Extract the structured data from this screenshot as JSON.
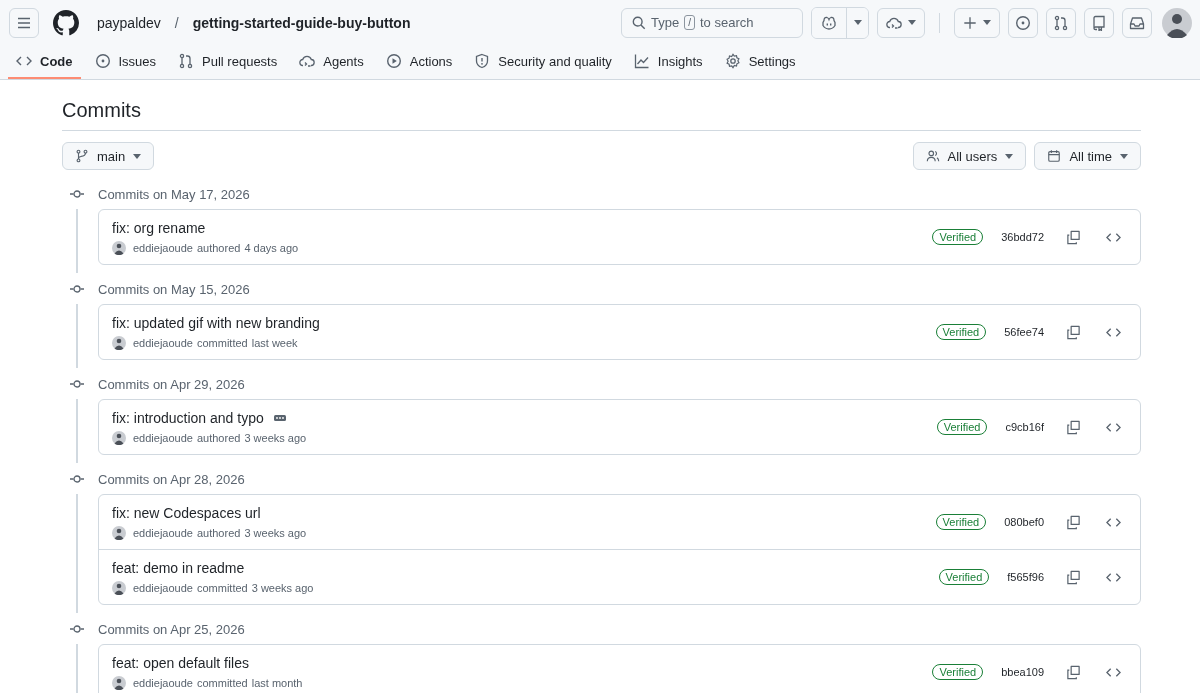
{
  "header": {
    "owner": "paypaldev",
    "separator": "/",
    "repo": "getting-started-guide-buy-button",
    "search": {
      "placeholder_parts": [
        "Type",
        "/",
        "to search"
      ]
    }
  },
  "tabs": [
    {
      "label": "Code",
      "selected": true
    },
    {
      "label": "Issues",
      "selected": false
    },
    {
      "label": "Pull requests",
      "selected": false
    },
    {
      "label": "Agents",
      "selected": false
    },
    {
      "label": "Actions",
      "selected": false
    },
    {
      "label": "Security and quality",
      "selected": false
    },
    {
      "label": "Insights",
      "selected": false
    },
    {
      "label": "Settings",
      "selected": false
    }
  ],
  "page_title": "Commits",
  "branch": "main",
  "filters": [
    {
      "label": "All users"
    },
    {
      "label": "All time"
    }
  ],
  "groups": [
    {
      "date": "Commits on May 17, 2026",
      "commits": [
        {
          "title": "fix: org rename",
          "has_more": false,
          "author": "eddiejaoude",
          "action": "authored",
          "time": "4 days ago",
          "badge": "Verified",
          "sha": "36bdd72"
        }
      ]
    },
    {
      "date": "Commits on May 15, 2026",
      "commits": [
        {
          "title": "fix: updated gif with new branding",
          "has_more": false,
          "author": "eddiejaoude",
          "action": "committed",
          "time": "last week",
          "badge": "Verified",
          "sha": "56fee74"
        }
      ]
    },
    {
      "date": "Commits on Apr 29, 2026",
      "commits": [
        {
          "title": "fix: introduction and typo",
          "has_more": true,
          "author": "eddiejaoude",
          "action": "authored",
          "time": "3 weeks ago",
          "badge": "Verified",
          "sha": "c9cb16f"
        }
      ]
    },
    {
      "date": "Commits on Apr 28, 2026",
      "commits": [
        {
          "title": "fix: new Codespaces url",
          "has_more": false,
          "author": "eddiejaoude",
          "action": "authored",
          "time": "3 weeks ago",
          "badge": "Verified",
          "sha": "080bef0"
        },
        {
          "title": "feat: demo in readme",
          "has_more": false,
          "author": "eddiejaoude",
          "action": "committed",
          "time": "3 weeks ago",
          "badge": "Verified",
          "sha": "f565f96"
        }
      ]
    },
    {
      "date": "Commits on Apr 25, 2026",
      "commits": [
        {
          "title": "feat: open default files",
          "has_more": false,
          "author": "eddiejaoude",
          "action": "committed",
          "time": "last month",
          "badge": "Verified",
          "sha": "bbea109"
        }
      ]
    }
  ]
}
